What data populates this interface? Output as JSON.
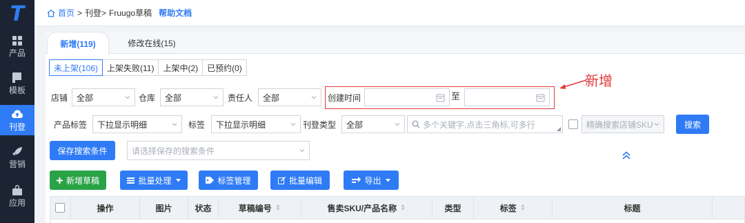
{
  "app": {
    "logo_text": "T",
    "sidebar": [
      {
        "label": "产品",
        "icon": "grid-icon"
      },
      {
        "label": "模板",
        "icon": "template-icon"
      },
      {
        "label": "刊登",
        "icon": "cloud-upload-icon",
        "active": true
      },
      {
        "label": "营销",
        "icon": "rocket-icon"
      },
      {
        "label": "应用",
        "icon": "bag-icon"
      }
    ],
    "accent": "#2f7bf5",
    "sidebar_bg": "#1c2433"
  },
  "breadcrumb": {
    "home": "首页",
    "sep1": ">",
    "item1": "刊登>",
    "current": "Fruugo草稿",
    "help": "帮助文档"
  },
  "tabs": [
    {
      "label": "新增(119)",
      "active": true
    },
    {
      "label": "修改在线(15)",
      "active": false
    }
  ],
  "subtabs": [
    {
      "label": "未上架(106)",
      "active": true
    },
    {
      "label": "上架失败(11)",
      "active": false
    },
    {
      "label": "上架中(2)",
      "active": false
    },
    {
      "label": "已预约(0)",
      "active": false
    }
  ],
  "filters": {
    "store_label": "店铺",
    "store_value": "全部",
    "warehouse_label": "仓库",
    "warehouse_value": "全部",
    "owner_label": "责任人",
    "owner_value": "全部",
    "created_label": "创建时间",
    "to_label": "至",
    "product_tag_label": "产品标签",
    "product_tag_value": "下拉显示明细",
    "tag_label": "标签",
    "tag_value": "下拉显示明细",
    "listing_type_label": "刊登类型",
    "listing_type_value": "全部",
    "keyword_placeholder": "多个关键字,点击三角标,可多行",
    "exact_sku_label": "精确搜索店铺SKU",
    "search_button": "搜索",
    "save_search_button": "保存搜索条件",
    "saved_search_placeholder": "请选择保存的搜索条件"
  },
  "annotation": {
    "text": "新增",
    "color": "#e23b3b"
  },
  "toolbar": {
    "new_draft": "新增草稿",
    "batch_process": "批量处理",
    "tag_manage": "标签管理",
    "batch_edit": "批量编辑",
    "export": "导出"
  },
  "table": {
    "columns": [
      {
        "label": "操作",
        "sortable": false
      },
      {
        "label": "图片",
        "sortable": false
      },
      {
        "label": "状态",
        "sortable": false
      },
      {
        "label": "草稿编号",
        "sortable": true
      },
      {
        "label": "售卖SKU/产品名称",
        "sortable": true
      },
      {
        "label": "类型",
        "sortable": false
      },
      {
        "label": "标签",
        "sortable": true
      },
      {
        "label": "标题",
        "sortable": false
      }
    ],
    "sort_glyph": "⇕"
  }
}
